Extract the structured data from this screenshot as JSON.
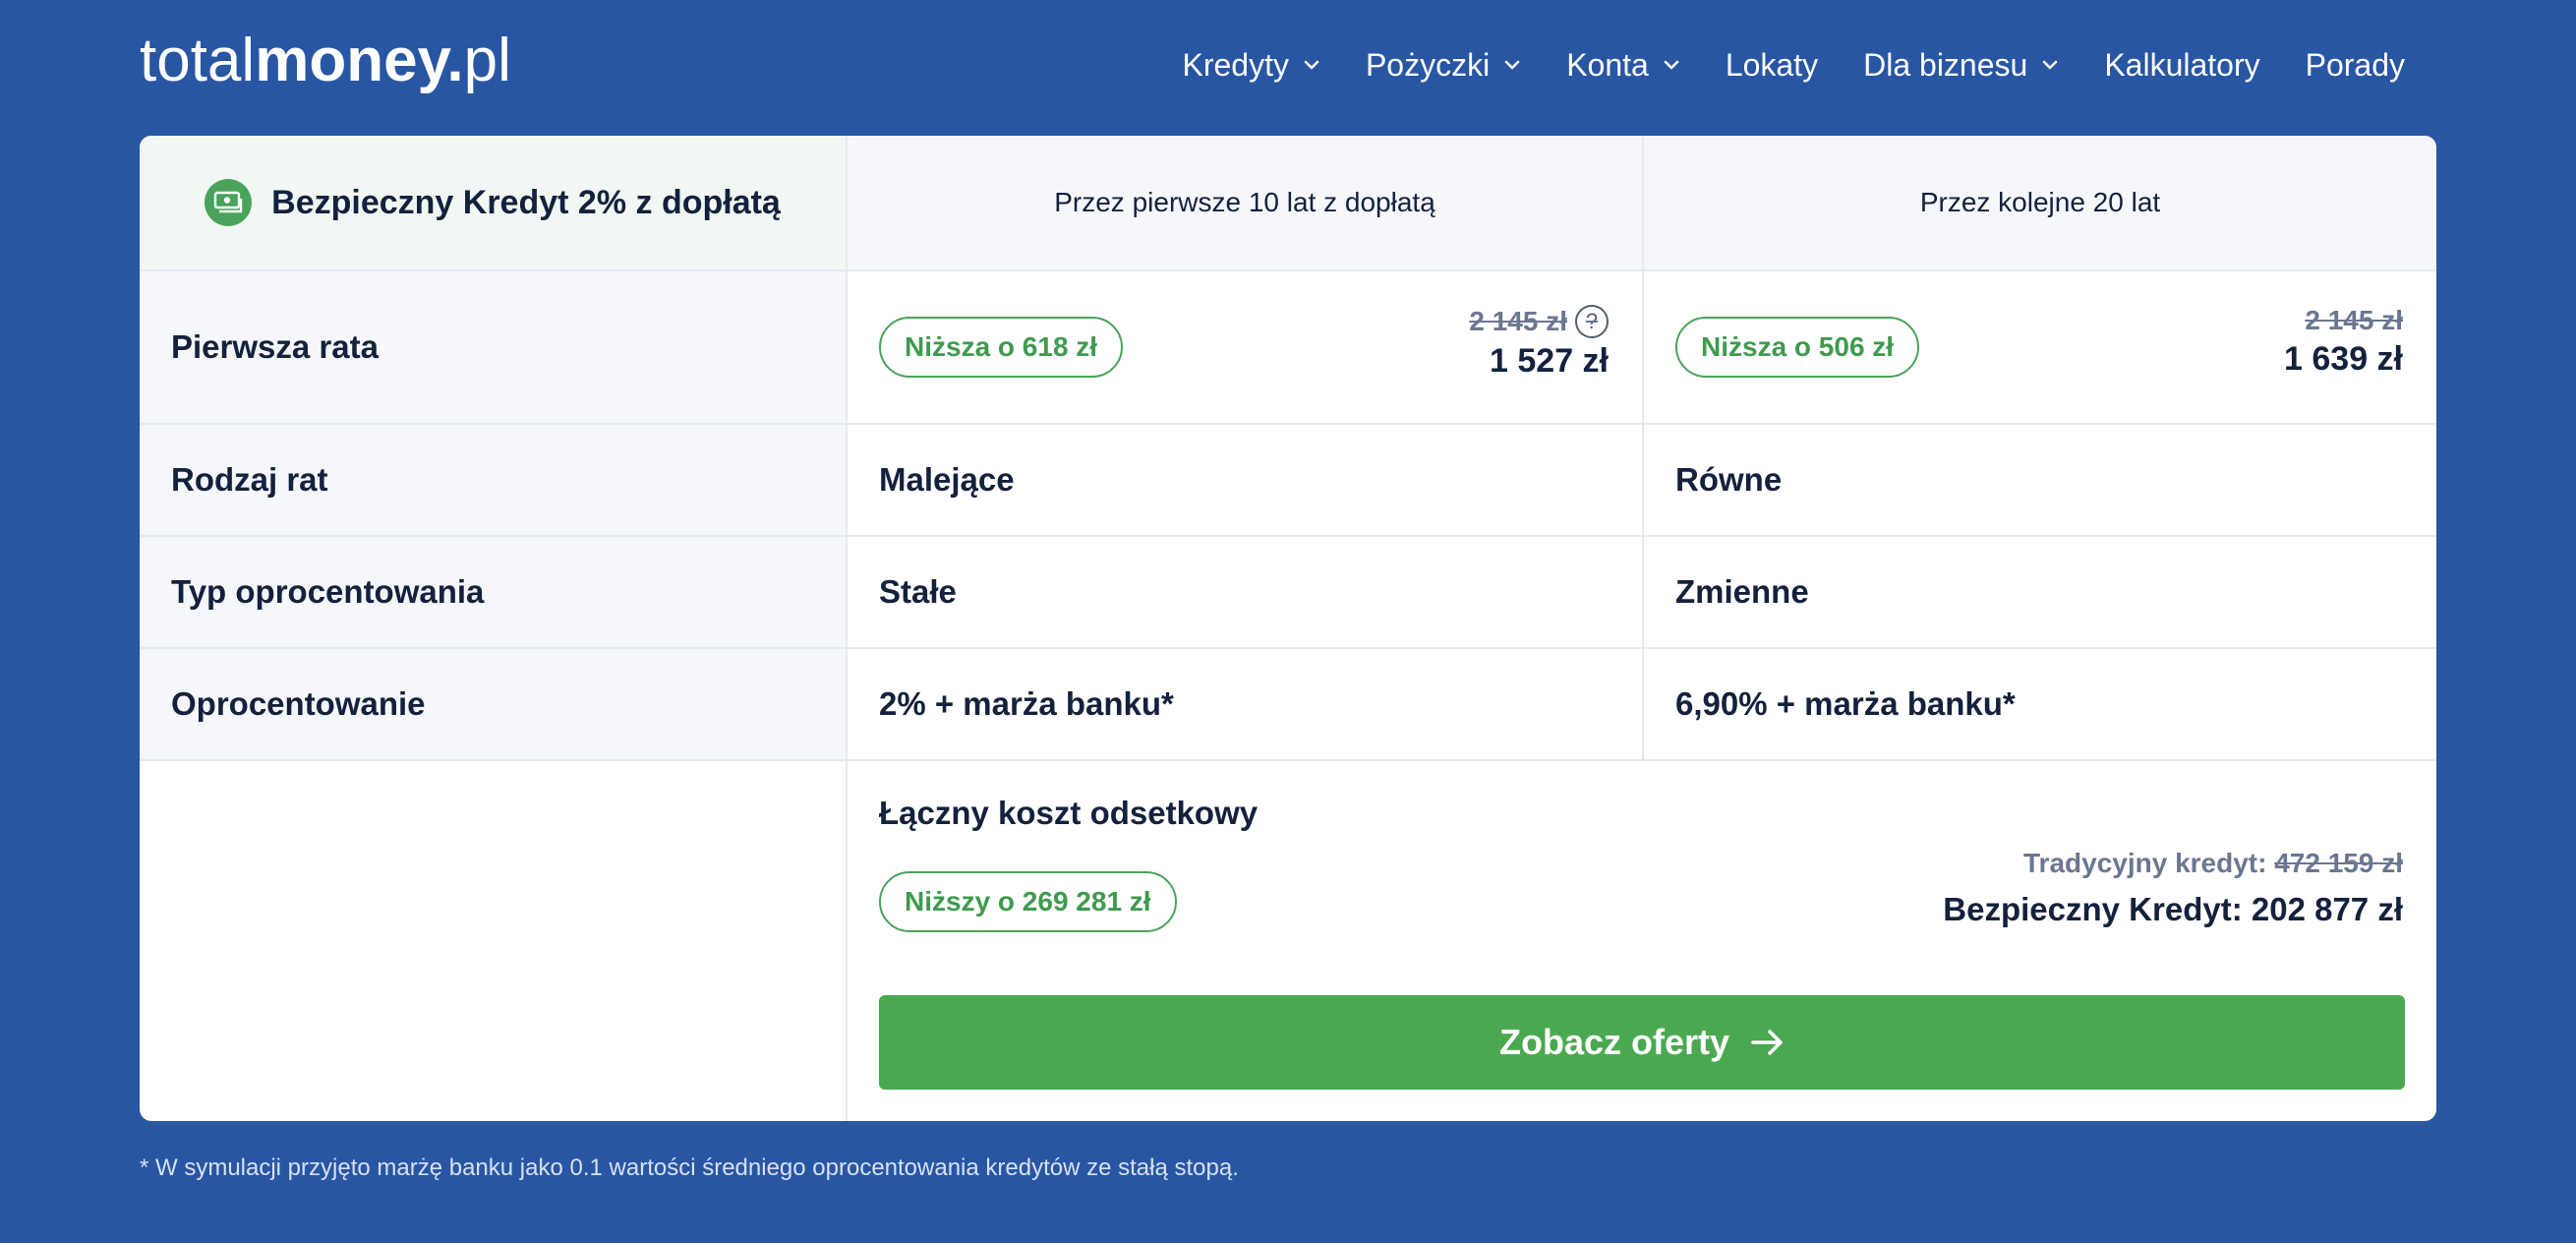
{
  "logo": {
    "light": "total",
    "bold": "money.",
    "suffix": "pl"
  },
  "nav": {
    "items": [
      {
        "label": "Kredyty",
        "dropdown": true
      },
      {
        "label": "Pożyczki",
        "dropdown": true
      },
      {
        "label": "Konta",
        "dropdown": true
      },
      {
        "label": "Lokaty",
        "dropdown": false
      },
      {
        "label": "Dla biznesu",
        "dropdown": true
      },
      {
        "label": "Kalkulatory",
        "dropdown": false
      },
      {
        "label": "Porady",
        "dropdown": false
      }
    ]
  },
  "table": {
    "header": {
      "product": "Bezpieczny Kredyt 2% z dopłatą",
      "period1": "Przez pierwsze 10 lat z dopłatą",
      "period2": "Przez kolejne 20 lat"
    },
    "rows": {
      "first_installment": {
        "label": "Pierwsza rata",
        "p1": {
          "pill": "Niższa o 618 zł",
          "old": "2 145 zł",
          "new": "1 527 zł"
        },
        "p2": {
          "pill": "Niższa o 506 zł",
          "old": "2 145 zł",
          "new": "1 639 zł"
        }
      },
      "installment_type": {
        "label": "Rodzaj rat",
        "p1": "Malejące",
        "p2": "Równe"
      },
      "rate_type": {
        "label": "Typ oprocentowania",
        "p1": "Stałe",
        "p2": "Zmienne"
      },
      "interest": {
        "label": "Oprocentowanie",
        "p1": "2% + marża banku*",
        "p2": "6,90% + marża banku*"
      }
    },
    "total": {
      "title": "Łączny koszt odsetkowy",
      "pill": "Niższy o 269 281 zł",
      "traditional_label": "Tradycyjny kredyt:",
      "traditional_value": "472 159 zł",
      "safe_label": "Bezpieczny Kredyt:",
      "safe_value": "202 877 zł"
    },
    "cta_label": "Zobacz oferty"
  },
  "footnote": "* W symulacji przyjęto marżę banku jako 0.1 wartości średniego oprocentowania kredytów ze stałą stopą.",
  "colors": {
    "background": "#2856a3",
    "accent_green": "#4aa950",
    "text": "#14213d"
  }
}
